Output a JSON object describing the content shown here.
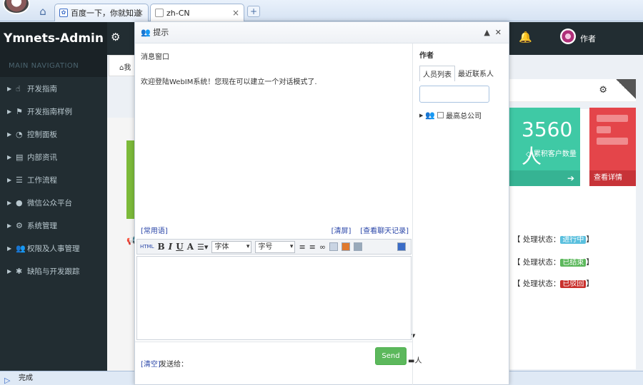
{
  "browser": {
    "tabs": [
      {
        "label": "百度一下，你就知道",
        "favicon": "baidu-paw"
      },
      {
        "label": "zh-CN",
        "favicon": "page"
      }
    ],
    "status_text": "完成"
  },
  "app": {
    "brand": "Ymnets-Admin",
    "user_name": "作者",
    "nav_header": "MAIN NAVIGATION",
    "nav_items": [
      {
        "label": "开发指南",
        "icon": "hand-pointer"
      },
      {
        "label": "开发指南样例",
        "icon": "flag"
      },
      {
        "label": "控制面板",
        "icon": "dashboard"
      },
      {
        "label": "内部资讯",
        "icon": "newspaper"
      },
      {
        "label": "工作流程",
        "icon": "list-ol"
      },
      {
        "label": "微信公众平台",
        "icon": "wechat"
      },
      {
        "label": "系统管理",
        "icon": "cogs"
      },
      {
        "label": "权限及人事管理",
        "icon": "users"
      },
      {
        "label": "缺陷与开发跟踪",
        "icon": "bug"
      }
    ],
    "breadcrumb_char": "我",
    "stat_card": {
      "value": "3560人",
      "label": "累积客户数量"
    },
    "red_card_footer": "查看详情",
    "status_rows": [
      {
        "prefix": "【 处理状态：",
        "tag": "进行中",
        "color": "#5bc0de",
        "suffix": "】"
      },
      {
        "prefix": "【 处理状态：",
        "tag": "已结束",
        "color": "#5cb85c",
        "suffix": "】"
      },
      {
        "prefix": "【 处理状态：",
        "tag": "已驳回",
        "color": "#d9534f",
        "suffix": "】"
      }
    ]
  },
  "dialog": {
    "title": "提示",
    "message_heading": "消息窗口",
    "welcome_text": "欢迎登陆WebIM系统！您现在可以建立一个对话模式了.",
    "link_common": "[常用语]",
    "link_clear_screen": "[清屏]",
    "link_history": "[查看聊天记录]",
    "toolbar": {
      "html_label": "HTML",
      "bold": "B",
      "italic": "I",
      "underline": "U",
      "font_color": "A",
      "font_select": "字体",
      "size_select": "字号"
    },
    "clear_link": "[清空]",
    "send_to_label": "发送给：",
    "send_button": "Send",
    "side": {
      "author_label": "作者",
      "tab_people": "人员列表",
      "tab_recent": "最近联系人",
      "search_value": "",
      "tree_root": "最高总公司"
    },
    "outside_label": "人"
  }
}
